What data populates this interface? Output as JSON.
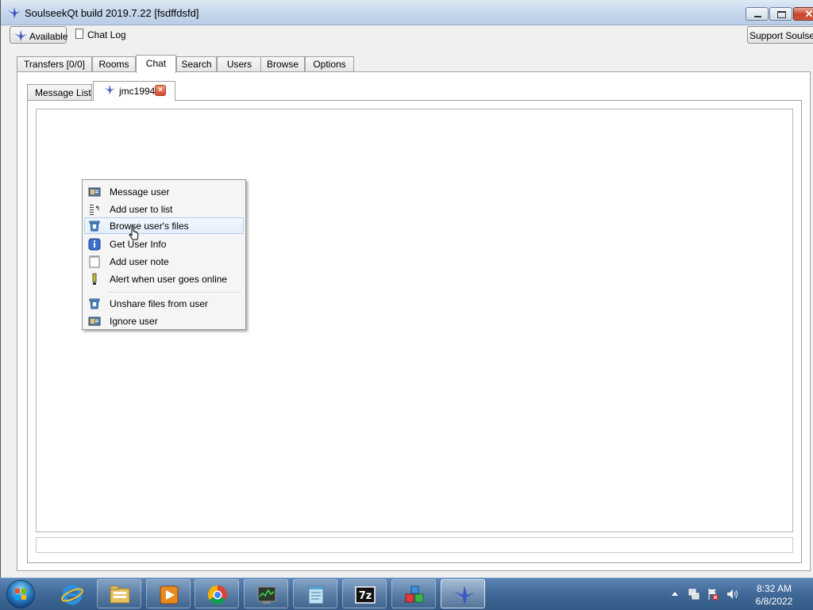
{
  "window": {
    "title": "SoulseekQt build 2019.7.22 [fsdffdsfd]"
  },
  "toolbar": {
    "status_label": "Available",
    "chat_log_label": "Chat Log",
    "support_label": "Support Soulseek"
  },
  "main_tabs": [
    "Transfers [0/0]",
    "Rooms",
    "Chat",
    "Search",
    "Users",
    "Browse",
    "Options"
  ],
  "active_main_tab": "Chat",
  "chat_tabs": {
    "message_list": "Message List",
    "user": "jmc1994",
    "close_glyph": "×"
  },
  "context_menu": {
    "items": [
      {
        "label": "Message user",
        "icon": "message-user-icon"
      },
      {
        "label": "Add user to list",
        "icon": "add-to-list-icon"
      },
      {
        "label": "Browse user's files",
        "icon": "browse-files-icon"
      },
      {
        "label": "Get User Info",
        "icon": "info-icon"
      },
      {
        "label": "Add user note",
        "icon": "note-icon"
      },
      {
        "label": "Alert when user goes online",
        "icon": "alert-icon"
      },
      {
        "label": "Unshare files from user",
        "icon": "unshare-icon"
      },
      {
        "label": "Ignore user",
        "icon": "ignore-user-icon"
      }
    ],
    "hovered": "Browse user's files"
  },
  "taskbar": {
    "apps": [
      "internet-explorer-icon",
      "file-explorer-icon",
      "media-player-icon",
      "chrome-icon",
      "task-manager-icon",
      "notepad-icon",
      "7zip-icon",
      "cubes-app-icon",
      "soulseek-icon"
    ],
    "sevenzip_label": "7z",
    "clock_time": "8:32 AM",
    "clock_date": "6/8/2022"
  },
  "colors": {
    "accent_bird": "#3d56c4",
    "close_red": "#d7472a",
    "taskbar": "#3f6896"
  }
}
